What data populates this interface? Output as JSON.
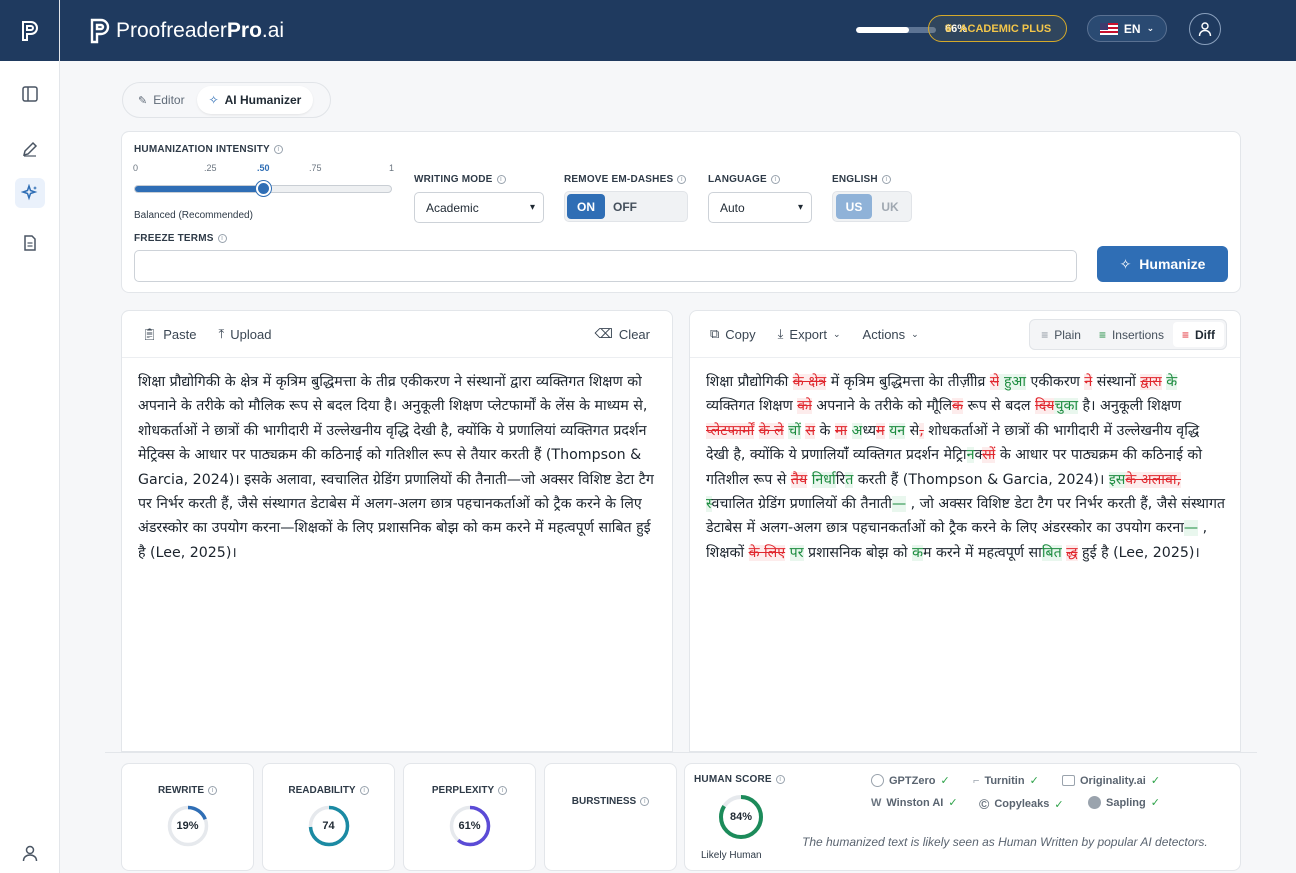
{
  "brand": {
    "name": "Proofreader",
    "name_bold": "Pro",
    "suffix": ".ai"
  },
  "topbar": {
    "usage_percent": 66,
    "usage_label": "66%",
    "plan": "ACADEMIC PLUS",
    "language": "EN"
  },
  "tabs": [
    {
      "label": "Editor"
    },
    {
      "label": "AI Humanizer"
    }
  ],
  "settings": {
    "intensity_label": "HUMANIZATION INTENSITY",
    "ticks": [
      "0",
      ".25",
      ".50",
      ".75",
      "1"
    ],
    "intensity_value": 0.5,
    "intensity_note": "Balanced (Recommended)",
    "writing_mode_label": "WRITING MODE",
    "writing_mode": "Academic",
    "em_dash_label": "REMOVE EM-DASHES",
    "on": "ON",
    "off": "OFF",
    "language_label": "LANGUAGE",
    "language": "Auto",
    "english_label": "ENGLISH",
    "us": "US",
    "uk": "UK",
    "freeze_label": "FREEZE TERMS",
    "freeze_value": "",
    "humanize": "Humanize"
  },
  "input_panel": {
    "paste": "Paste",
    "upload": "Upload",
    "clear": "Clear",
    "text": "शिक्षा प्रौद्योगिकी के क्षेत्र में कृत्रिम बुद्धिमत्ता के तीव्र एकीकरण ने संस्थानों द्वारा व्यक्तिगत शिक्षण को अपनाने के तरीके को मौलिक रूप से बदल दिया है। अनुकूली शिक्षण प्लेटफार्मों के लेंस के माध्यम से, शोधकर्ताओं ने छात्रों की भागीदारी में उल्लेखनीय वृद्धि देखी है, क्योंकि ये प्रणालियां व्यक्तिगत प्रदर्शन मेट्रिक्स के आधार पर पाठ्यक्रम की कठिनाई को गतिशील रूप से तैयार करती हैं (Thompson & Garcia, 2024)। इसके अलावा, स्वचालित ग्रेडिंग प्रणालियों की तैनाती—जो अक्सर विशिष्ट डेटा टैग पर निर्भर करती हैं, जैसे संस्थागत डेटाबेस में अलग-अलग छात्र पहचानकर्ताओं को ट्रैक करने के लिए अंडरस्कोर का उपयोग करना—शिक्षकों के लिए प्रशासनिक बोझ को कम करने में महत्वपूर्ण साबित हुई है (Lee, 2025)।"
  },
  "output_panel": {
    "copy": "Copy",
    "export": "Export",
    "actions": "Actions",
    "views": [
      "Plain",
      "Insertions",
      "Diff"
    ],
    "segments": [
      [
        "n",
        "शिक्षा प्रौद्योगिकी "
      ],
      [
        "d",
        "के क्षेत्र"
      ],
      [
        "n",
        " में कृत्रिम बुद्धिमत्ता क"
      ],
      [
        "d",
        "े"
      ],
      [
        "i",
        "ा"
      ],
      [
        "n",
        " त"
      ],
      [
        "d",
        "ी"
      ],
      [
        "i",
        "े"
      ],
      [
        "n",
        "ज़"
      ],
      [
        "d",
        "ी"
      ],
      [
        "i",
        "ी"
      ],
      [
        "n",
        "व्र "
      ],
      [
        "d",
        "से"
      ],
      [
        "i",
        " हुआ"
      ],
      [
        "n",
        " एकीकरण "
      ],
      [
        "d",
        "ने"
      ],
      [
        "n",
        " संस्थानों "
      ],
      [
        "d",
        "द्वारा"
      ],
      [
        "n",
        " "
      ],
      [
        "i",
        "के"
      ],
      [
        "n",
        " व्यक्तिगत शिक्षण "
      ],
      [
        "d",
        "को"
      ],
      [
        "n",
        " अपनाने के तरीके को म"
      ],
      [
        "d",
        "ौ"
      ],
      [
        "i",
        "ू"
      ],
      [
        "n",
        "ल"
      ],
      [
        "d",
        "िक"
      ],
      [
        "n",
        " रूप से बदल "
      ],
      [
        "d",
        "दिय"
      ],
      [
        "i",
        "चुक"
      ],
      [
        "n",
        "ा है। अनुकूली शिक्षण "
      ],
      [
        "d",
        "प्लेटफार्"
      ],
      [
        "n",
        "म"
      ],
      [
        "d",
        "ो"
      ],
      [
        "i",
        "ं"
      ],
      [
        "n",
        " "
      ],
      [
        "d",
        "के ले"
      ],
      [
        "n",
        " "
      ],
      [
        "i",
        "चो"
      ],
      [
        "d",
        "ं"
      ],
      [
        "n",
        " "
      ],
      [
        "d",
        "स"
      ],
      [
        "n",
        " के "
      ],
      [
        "d",
        "मा"
      ],
      [
        "n",
        " "
      ],
      [
        "i",
        "अ"
      ],
      [
        "n",
        "ध्य"
      ],
      [
        "d",
        "म"
      ],
      [
        "n",
        " "
      ],
      [
        "i",
        "यन"
      ],
      [
        "n",
        " से"
      ],
      [
        "d",
        ","
      ],
      [
        "n",
        " शोधकर्ताओं ने छात्रों की भागीदारी में उल्लेखनीय वृद्धि देखी है, क्योंकि ये प्रणालिया"
      ],
      [
        "d",
        "ं"
      ],
      [
        "i",
        "ँ"
      ],
      [
        "n",
        " व्यक्तिगत प्रदर्शन म"
      ],
      [
        "d",
        "े"
      ],
      [
        "n",
        "ट्रि"
      ],
      [
        "i",
        "ान"
      ],
      [
        "n",
        "क"
      ],
      [
        "d",
        "्स"
      ],
      [
        "i",
        "ों"
      ],
      [
        "n",
        " के आधार पर पाठ्यक्रम की कठिनाई को गतिशील रूप से "
      ],
      [
        "d",
        "तैय"
      ],
      [
        "n",
        " "
      ],
      [
        "i",
        "निर्ध"
      ],
      [
        "n",
        "ा"
      ],
      [
        "n",
        "र"
      ],
      [
        "i",
        "ित"
      ],
      [
        "n",
        " करती हैं (Thompson & Garcia, 2024)। "
      ],
      [
        "i",
        "इस"
      ],
      [
        "d",
        "के अलावा,"
      ],
      [
        "n",
        " "
      ],
      [
        "i",
        "स"
      ],
      [
        "d",
        "्"
      ],
      [
        "n",
        "वचालित ग्रेडिंग प्रणालियों की तैनाती"
      ],
      [
        "i",
        "—"
      ],
      [
        "n",
        " , जो अक्सर विशिष्ट डेटा टैग पर निर्भर करती है"
      ],
      [
        "d",
        "ं"
      ],
      [
        "n",
        ", जैसे संस्थागत डेटाबेस में अलग-अलग छात्र पहचानकर्ताओं को ट्रैक करने के लिए अंडरस्कोर का उपयोग करना"
      ],
      [
        "i",
        "—"
      ],
      [
        "n",
        " , शिक्षकों "
      ],
      [
        "d",
        "के लिए"
      ],
      [
        "n",
        " "
      ],
      [
        "i",
        "पर"
      ],
      [
        "n",
        " प्रशासनिक बोझ क"
      ],
      [
        "d",
        "ो"
      ],
      [
        "n",
        " "
      ],
      [
        "i",
        "क"
      ],
      [
        "n",
        "म करने में महत्वपूर्ण स"
      ],
      [
        "d",
        "ा"
      ],
      [
        "i",
        "ब"
      ],
      [
        "n",
        "ि"
      ],
      [
        "i",
        "त"
      ],
      [
        "n",
        " "
      ],
      [
        "d",
        "द्ध"
      ],
      [
        "n",
        " हुई है (Lee, 2025)।"
      ]
    ]
  },
  "metrics": [
    {
      "label": "REWRITE",
      "value": 19,
      "display": "19%",
      "color": "#2f6eb5"
    },
    {
      "label": "READABILITY",
      "value": 74,
      "display": "74",
      "color": "#1b8aa3"
    },
    {
      "label": "PERPLEXITY",
      "value": 61,
      "display": "61%",
      "color": "#5b4bd6"
    },
    {
      "label": "BURSTINESS",
      "value": null,
      "display": "",
      "color": "#cccccc"
    }
  ],
  "human_score": {
    "label": "HUMAN SCORE",
    "value": 84,
    "display": "84%",
    "verdict": "Likely Human",
    "color": "#1c8b5a",
    "detectors": [
      "GPTZero",
      "Turnitin",
      "Originality.ai",
      "Winston AI",
      "Copyleaks",
      "Sapling"
    ],
    "note": "The humanized text is likely seen as Human Written by popular AI detectors."
  }
}
